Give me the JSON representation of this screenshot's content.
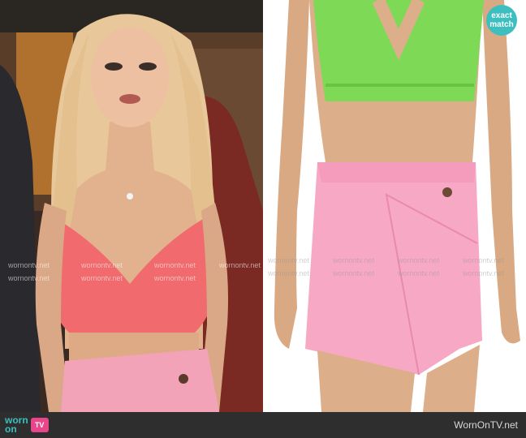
{
  "left_photo": {
    "subject": "woman-in-pink-crop-top-and-pink-mini-skirt"
  },
  "right_photo": {
    "subject": "product-photo-green-knit-bralette-and-pink-wrap-skort",
    "badge_line1": "exact",
    "badge_line2": "match"
  },
  "watermark_text": "wornontv.net",
  "footer": {
    "logo_line1": "worn",
    "logo_line2": "on",
    "logo_tv": "TV",
    "site_name": "WornOnTV.net"
  },
  "colors": {
    "accent": "#3dbfbf",
    "logo_tv": "#e8458b",
    "footer_bg": "#2e2e2e",
    "top_green": "#7ed957",
    "skirt_pink": "#f7a8c4",
    "crop_top_coral": "#f06a6e"
  }
}
